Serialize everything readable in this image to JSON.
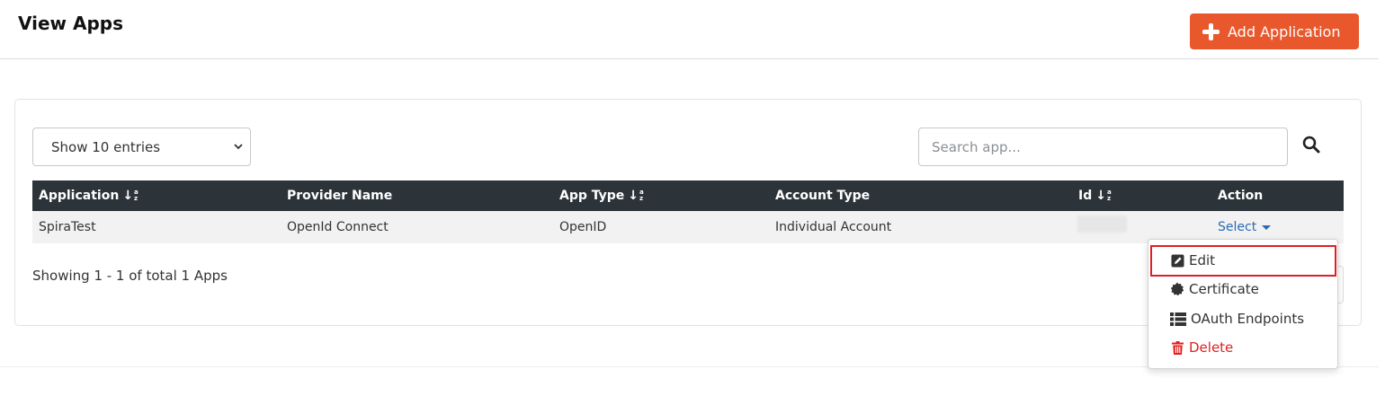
{
  "page": {
    "title": "View Apps"
  },
  "toolbar": {
    "add_label": "Add Application"
  },
  "controls": {
    "entries_selected": "Show 10 entries",
    "search_placeholder": "Search app..."
  },
  "table": {
    "columns": [
      "Application",
      "Provider Name",
      "App Type",
      "Account Type",
      "Id",
      "Action"
    ],
    "rows": [
      {
        "application": "SpiraTest",
        "provider": "OpenId Connect",
        "app_type": "OpenID",
        "account_type": "Individual Account",
        "id": "",
        "action": "Select"
      }
    ]
  },
  "footer": {
    "showing": "Showing 1 - 1 of total 1 Apps"
  },
  "action_menu": {
    "items": [
      "Edit",
      "Certificate",
      "OAuth Endpoints",
      "Delete"
    ]
  },
  "colors": {
    "accent": "#e9582d",
    "header_bg": "#2c343a",
    "link": "#2a6bb5",
    "danger": "#e0201f"
  }
}
